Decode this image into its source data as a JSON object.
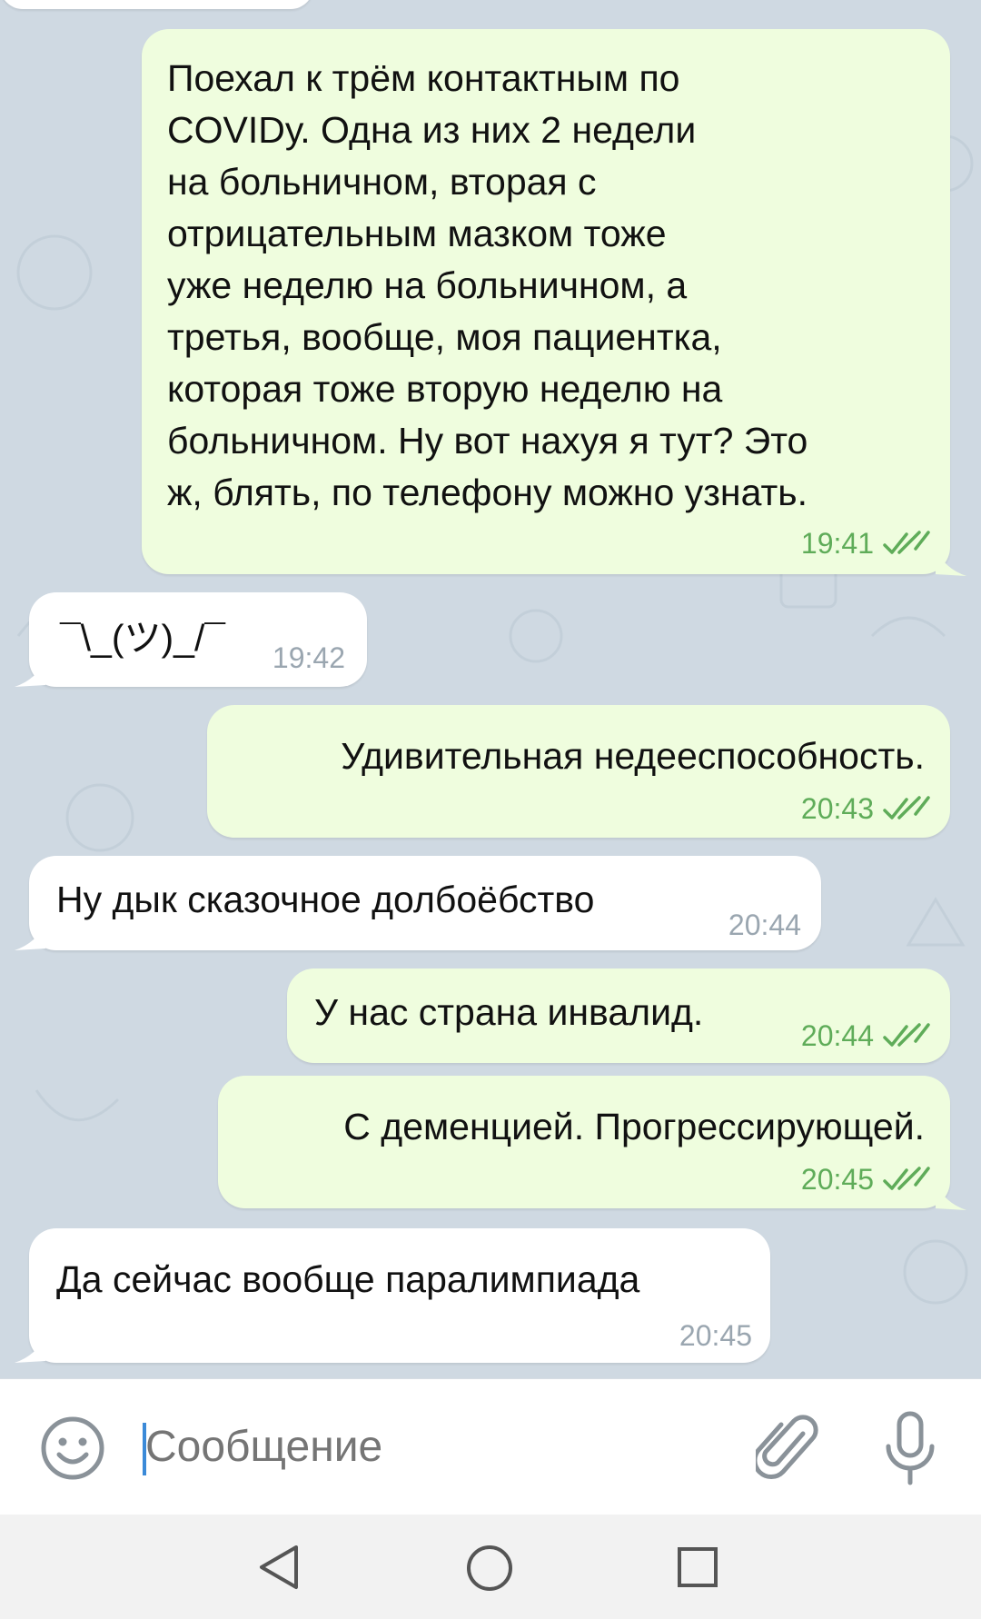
{
  "messages": [
    {
      "direction": "out",
      "text": "Поехал к трём контактным по\nCOVIDу. Одна из них 2 недели\nна больничном, вторая с\nотрицательным мазком тоже\nуже неделю на больничном, а\nтретья, вообще, моя пациентка,\nкоторая тоже вторую неделю на\nбольничном. Ну вот нахуя я тут? Это\nж, блять, по телефону можно узнать.",
      "time": "19:41",
      "read": true
    },
    {
      "direction": "in",
      "text": "¯\\_(ツ)_/¯",
      "time": "19:42"
    },
    {
      "direction": "out",
      "text": "Удивительная недееспособность.",
      "time": "20:43",
      "read": true
    },
    {
      "direction": "in",
      "text": "Ну дык сказочное долбоёбство",
      "time": "20:44"
    },
    {
      "direction": "out",
      "text": "У нас страна инвалид.",
      "time": "20:44",
      "read": true
    },
    {
      "direction": "out",
      "text": "С деменцией. Прогрессирующей.",
      "time": "20:45",
      "read": true
    },
    {
      "direction": "in",
      "text": "Да сейчас вообще паралимпиада",
      "time": "20:45"
    }
  ],
  "input": {
    "placeholder": "Сообщение",
    "value": ""
  },
  "icons": {
    "emoji": "smile-icon",
    "attach": "paperclip-icon",
    "mic": "microphone-icon",
    "read_receipt": "double-check-icon",
    "nav_back": "triangle-back-icon",
    "nav_home": "circle-home-icon",
    "nav_recents": "square-recents-icon"
  },
  "colors": {
    "chat_background": "#cfd9e2",
    "outgoing_bubble": "#effdde",
    "incoming_bubble": "#ffffff",
    "outgoing_time": "#5fac59",
    "incoming_time": "#9aa6b0",
    "cursor": "#3b8ad8"
  }
}
